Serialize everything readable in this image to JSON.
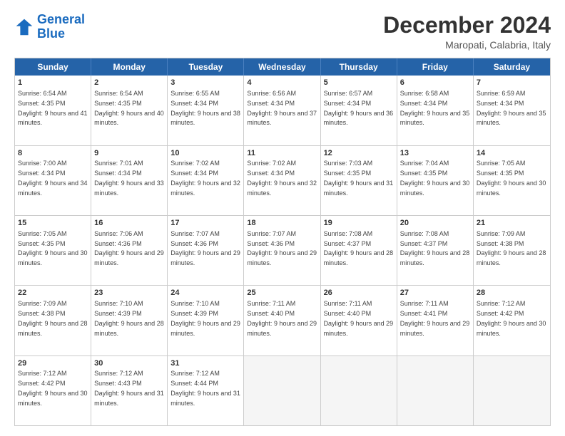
{
  "logo": {
    "text_general": "General",
    "text_blue": "Blue"
  },
  "title": "December 2024",
  "subtitle": "Maropati, Calabria, Italy",
  "header_days": [
    "Sunday",
    "Monday",
    "Tuesday",
    "Wednesday",
    "Thursday",
    "Friday",
    "Saturday"
  ],
  "weeks": [
    [
      {
        "day": "1",
        "rise": "Sunrise: 6:54 AM",
        "set": "Sunset: 4:35 PM",
        "daylight": "Daylight: 9 hours and 41 minutes."
      },
      {
        "day": "2",
        "rise": "Sunrise: 6:54 AM",
        "set": "Sunset: 4:35 PM",
        "daylight": "Daylight: 9 hours and 40 minutes."
      },
      {
        "day": "3",
        "rise": "Sunrise: 6:55 AM",
        "set": "Sunset: 4:34 PM",
        "daylight": "Daylight: 9 hours and 38 minutes."
      },
      {
        "day": "4",
        "rise": "Sunrise: 6:56 AM",
        "set": "Sunset: 4:34 PM",
        "daylight": "Daylight: 9 hours and 37 minutes."
      },
      {
        "day": "5",
        "rise": "Sunrise: 6:57 AM",
        "set": "Sunset: 4:34 PM",
        "daylight": "Daylight: 9 hours and 36 minutes."
      },
      {
        "day": "6",
        "rise": "Sunrise: 6:58 AM",
        "set": "Sunset: 4:34 PM",
        "daylight": "Daylight: 9 hours and 35 minutes."
      },
      {
        "day": "7",
        "rise": "Sunrise: 6:59 AM",
        "set": "Sunset: 4:34 PM",
        "daylight": "Daylight: 9 hours and 35 minutes."
      }
    ],
    [
      {
        "day": "8",
        "rise": "Sunrise: 7:00 AM",
        "set": "Sunset: 4:34 PM",
        "daylight": "Daylight: 9 hours and 34 minutes."
      },
      {
        "day": "9",
        "rise": "Sunrise: 7:01 AM",
        "set": "Sunset: 4:34 PM",
        "daylight": "Daylight: 9 hours and 33 minutes."
      },
      {
        "day": "10",
        "rise": "Sunrise: 7:02 AM",
        "set": "Sunset: 4:34 PM",
        "daylight": "Daylight: 9 hours and 32 minutes."
      },
      {
        "day": "11",
        "rise": "Sunrise: 7:02 AM",
        "set": "Sunset: 4:34 PM",
        "daylight": "Daylight: 9 hours and 32 minutes."
      },
      {
        "day": "12",
        "rise": "Sunrise: 7:03 AM",
        "set": "Sunset: 4:35 PM",
        "daylight": "Daylight: 9 hours and 31 minutes."
      },
      {
        "day": "13",
        "rise": "Sunrise: 7:04 AM",
        "set": "Sunset: 4:35 PM",
        "daylight": "Daylight: 9 hours and 30 minutes."
      },
      {
        "day": "14",
        "rise": "Sunrise: 7:05 AM",
        "set": "Sunset: 4:35 PM",
        "daylight": "Daylight: 9 hours and 30 minutes."
      }
    ],
    [
      {
        "day": "15",
        "rise": "Sunrise: 7:05 AM",
        "set": "Sunset: 4:35 PM",
        "daylight": "Daylight: 9 hours and 30 minutes."
      },
      {
        "day": "16",
        "rise": "Sunrise: 7:06 AM",
        "set": "Sunset: 4:36 PM",
        "daylight": "Daylight: 9 hours and 29 minutes."
      },
      {
        "day": "17",
        "rise": "Sunrise: 7:07 AM",
        "set": "Sunset: 4:36 PM",
        "daylight": "Daylight: 9 hours and 29 minutes."
      },
      {
        "day": "18",
        "rise": "Sunrise: 7:07 AM",
        "set": "Sunset: 4:36 PM",
        "daylight": "Daylight: 9 hours and 29 minutes."
      },
      {
        "day": "19",
        "rise": "Sunrise: 7:08 AM",
        "set": "Sunset: 4:37 PM",
        "daylight": "Daylight: 9 hours and 28 minutes."
      },
      {
        "day": "20",
        "rise": "Sunrise: 7:08 AM",
        "set": "Sunset: 4:37 PM",
        "daylight": "Daylight: 9 hours and 28 minutes."
      },
      {
        "day": "21",
        "rise": "Sunrise: 7:09 AM",
        "set": "Sunset: 4:38 PM",
        "daylight": "Daylight: 9 hours and 28 minutes."
      }
    ],
    [
      {
        "day": "22",
        "rise": "Sunrise: 7:09 AM",
        "set": "Sunset: 4:38 PM",
        "daylight": "Daylight: 9 hours and 28 minutes."
      },
      {
        "day": "23",
        "rise": "Sunrise: 7:10 AM",
        "set": "Sunset: 4:39 PM",
        "daylight": "Daylight: 9 hours and 28 minutes."
      },
      {
        "day": "24",
        "rise": "Sunrise: 7:10 AM",
        "set": "Sunset: 4:39 PM",
        "daylight": "Daylight: 9 hours and 29 minutes."
      },
      {
        "day": "25",
        "rise": "Sunrise: 7:11 AM",
        "set": "Sunset: 4:40 PM",
        "daylight": "Daylight: 9 hours and 29 minutes."
      },
      {
        "day": "26",
        "rise": "Sunrise: 7:11 AM",
        "set": "Sunset: 4:40 PM",
        "daylight": "Daylight: 9 hours and 29 minutes."
      },
      {
        "day": "27",
        "rise": "Sunrise: 7:11 AM",
        "set": "Sunset: 4:41 PM",
        "daylight": "Daylight: 9 hours and 29 minutes."
      },
      {
        "day": "28",
        "rise": "Sunrise: 7:12 AM",
        "set": "Sunset: 4:42 PM",
        "daylight": "Daylight: 9 hours and 30 minutes."
      }
    ],
    [
      {
        "day": "29",
        "rise": "Sunrise: 7:12 AM",
        "set": "Sunset: 4:42 PM",
        "daylight": "Daylight: 9 hours and 30 minutes."
      },
      {
        "day": "30",
        "rise": "Sunrise: 7:12 AM",
        "set": "Sunset: 4:43 PM",
        "daylight": "Daylight: 9 hours and 31 minutes."
      },
      {
        "day": "31",
        "rise": "Sunrise: 7:12 AM",
        "set": "Sunset: 4:44 PM",
        "daylight": "Daylight: 9 hours and 31 minutes."
      },
      null,
      null,
      null,
      null
    ]
  ]
}
